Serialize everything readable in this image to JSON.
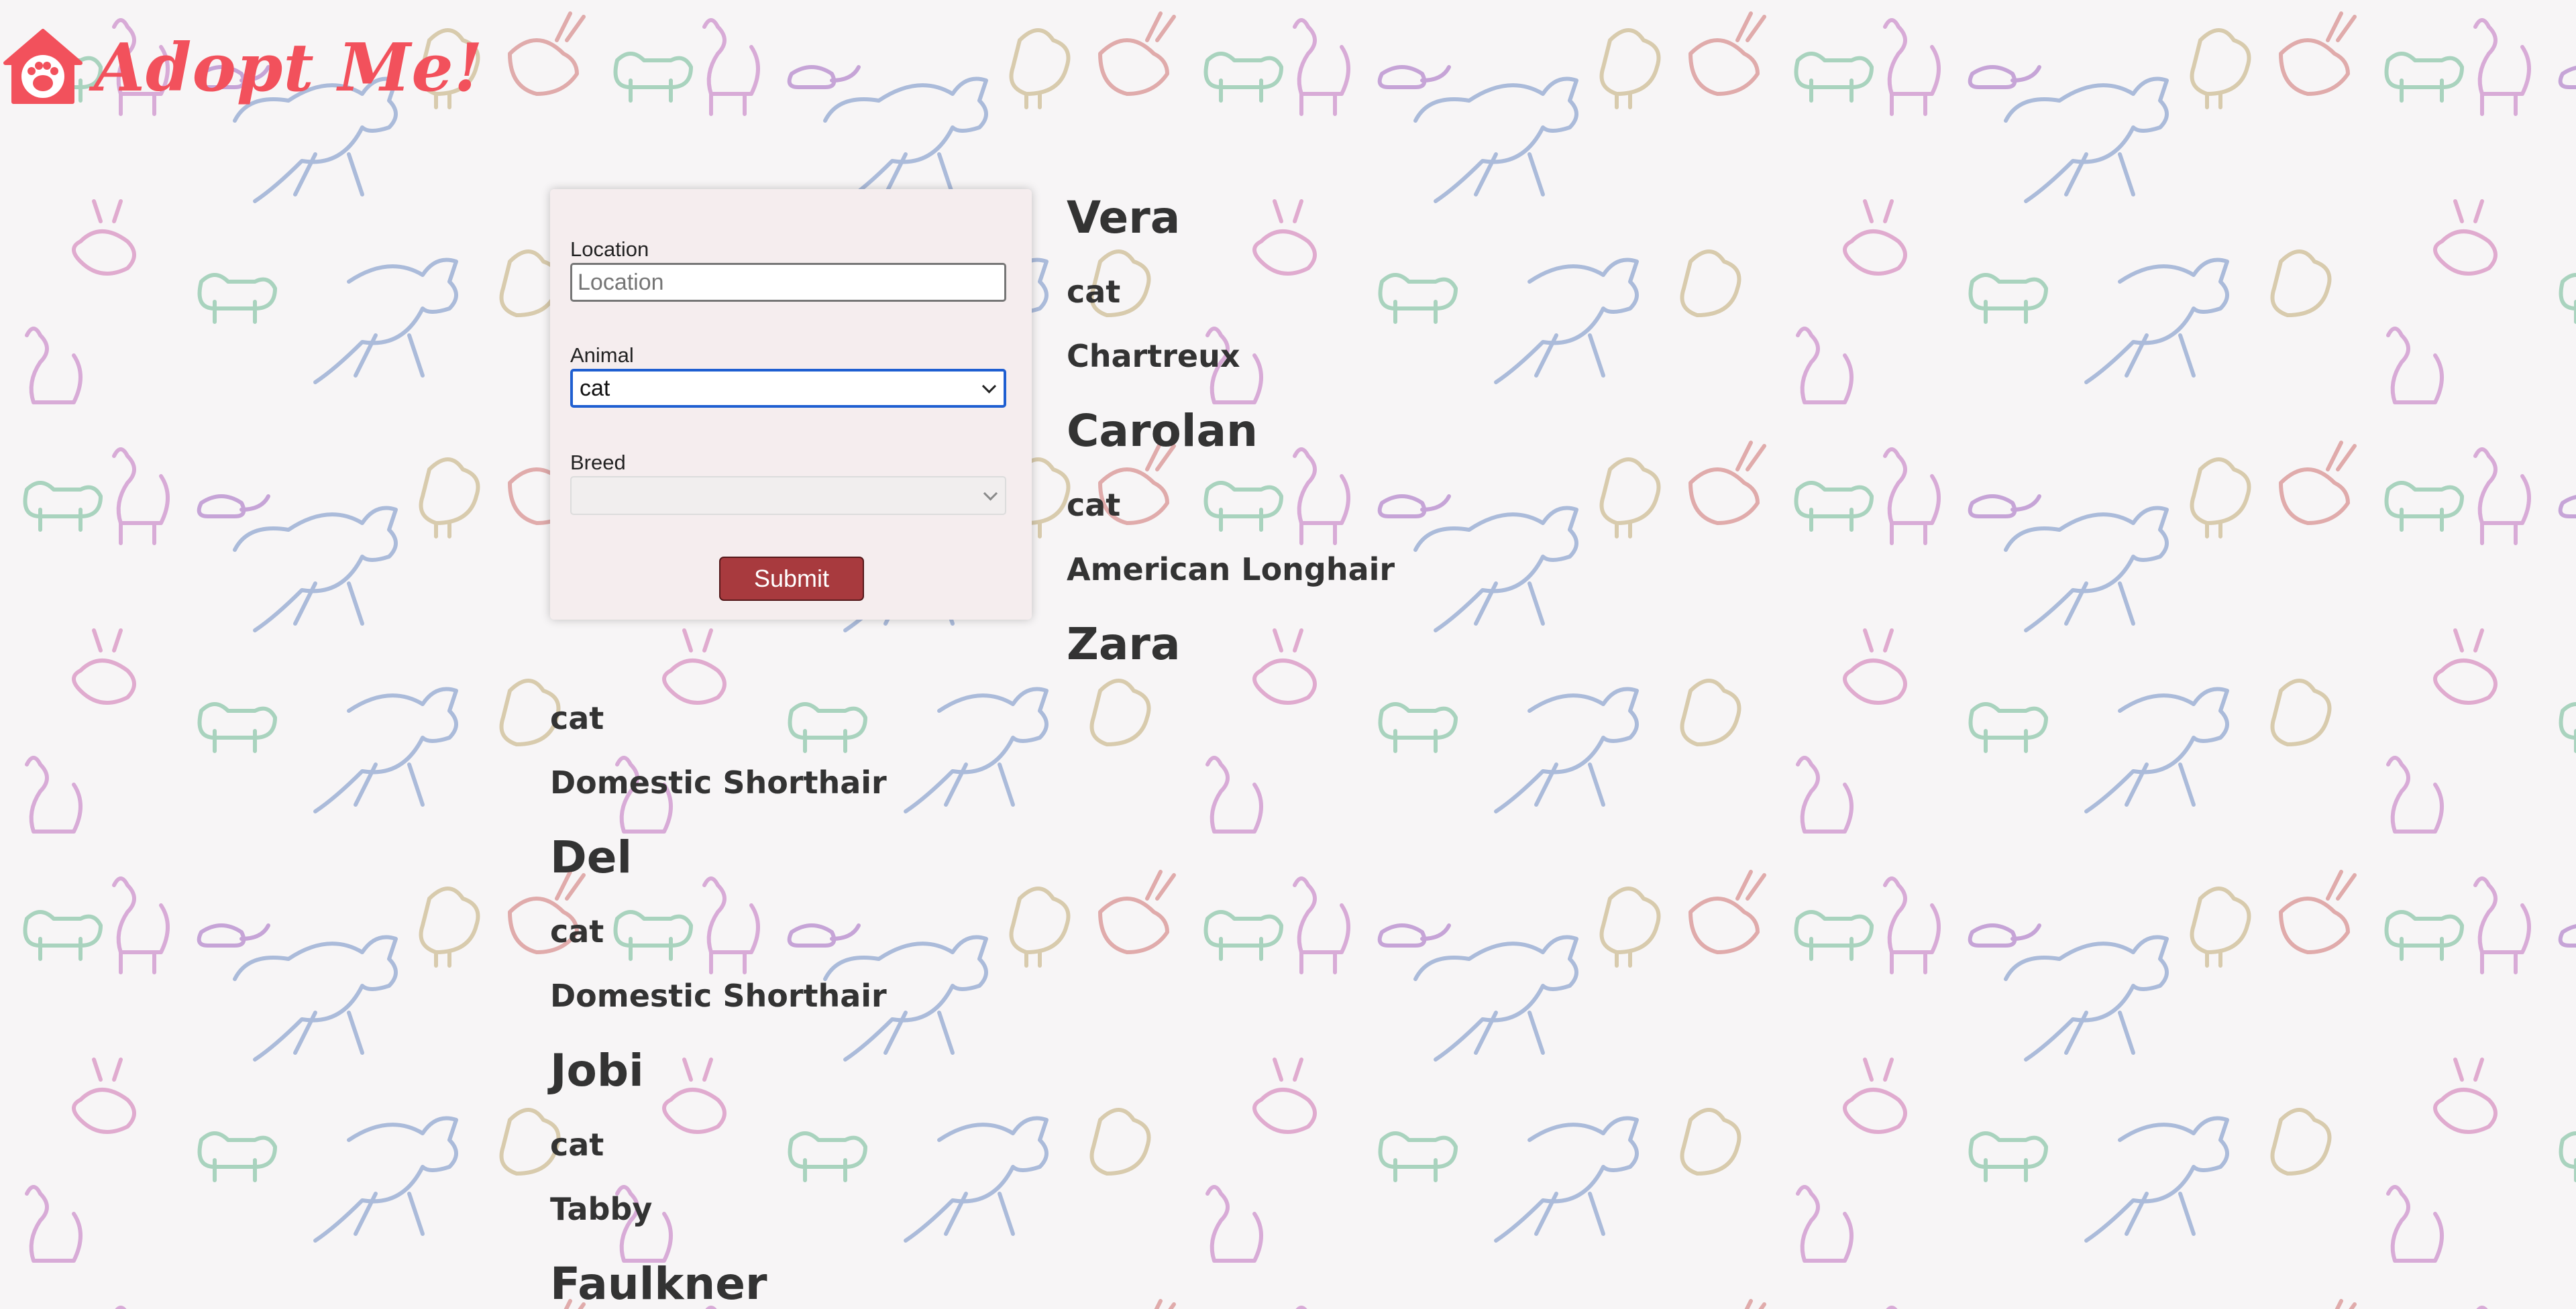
{
  "header": {
    "logo_text": "Adopt Me!",
    "logo_icon": "house-paw-icon",
    "accent_color": "#f2515c"
  },
  "search": {
    "location_label": "Location",
    "location_value": "",
    "location_placeholder": "Location",
    "animal_label": "Animal",
    "animal_selected": "cat",
    "breed_label": "Breed",
    "breed_selected": "",
    "submit_label": "Submit",
    "submit_color": "#a83a3e"
  },
  "pets": [
    {
      "name": "Vera",
      "animal": "cat",
      "breed": "Chartreux"
    },
    {
      "name": "Carolan",
      "animal": "cat",
      "breed": "American Longhair"
    },
    {
      "name": "Zara",
      "animal": "cat",
      "breed": "Domestic Shorthair"
    },
    {
      "name": "Del",
      "animal": "cat",
      "breed": "Domestic Shorthair"
    },
    {
      "name": "Jobi",
      "animal": "cat",
      "breed": "Tabby"
    },
    {
      "name": "Faulkner"
    }
  ]
}
